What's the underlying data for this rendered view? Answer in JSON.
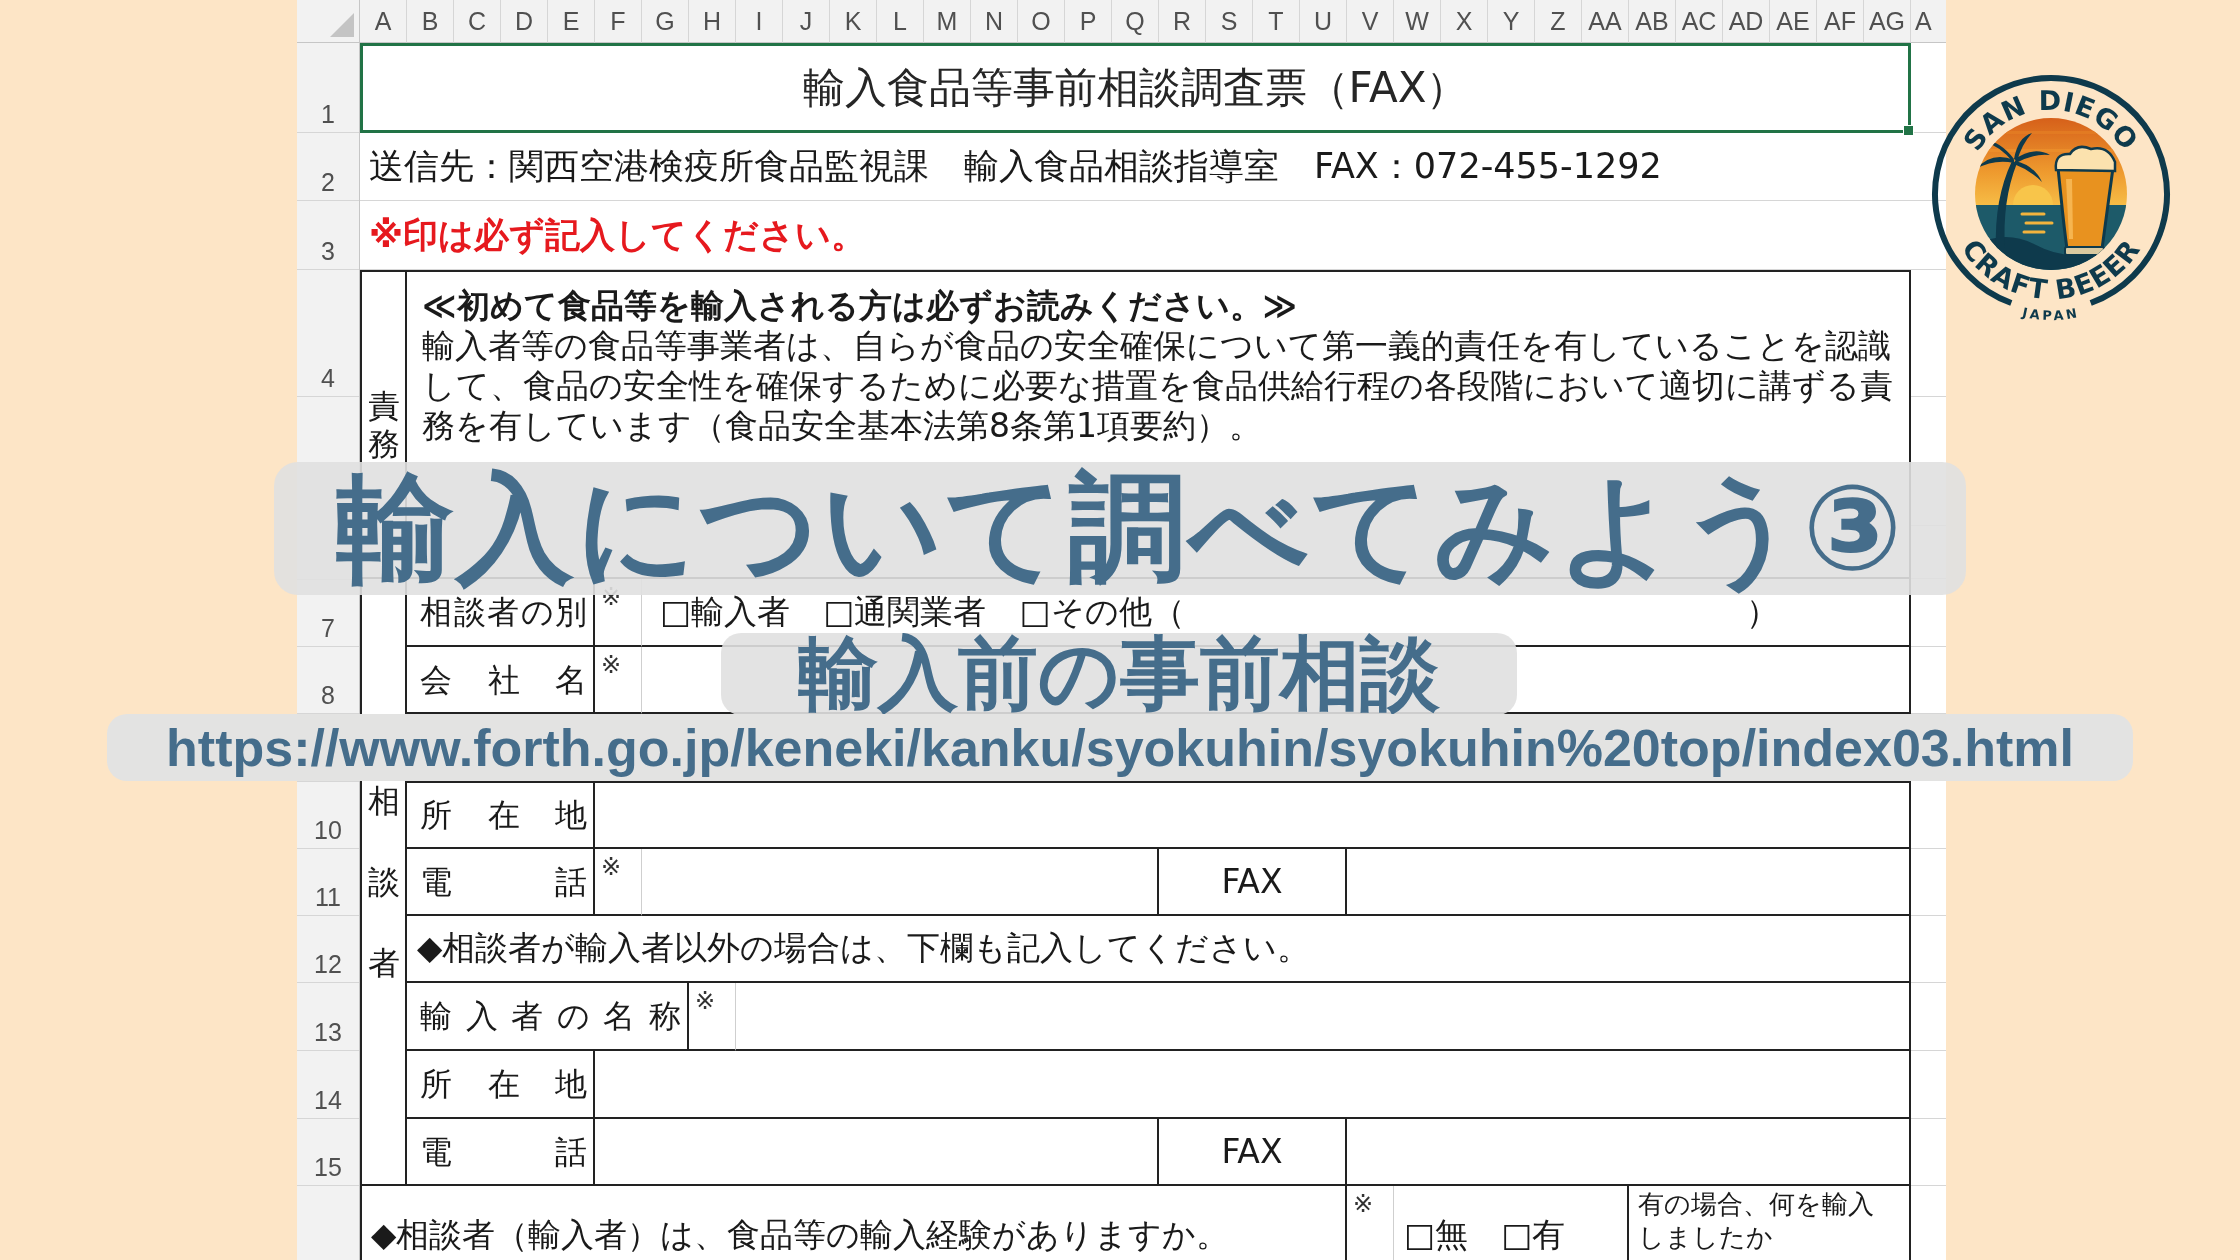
{
  "sheet": {
    "column_headers": [
      "A",
      "B",
      "C",
      "D",
      "E",
      "F",
      "G",
      "H",
      "I",
      "J",
      "K",
      "L",
      "M",
      "N",
      "O",
      "P",
      "Q",
      "R",
      "S",
      "T",
      "U",
      "V",
      "W",
      "X",
      "Y",
      "Z",
      "AA",
      "AB",
      "AC",
      "AD",
      "AE",
      "AF",
      "AG",
      "A"
    ],
    "title_row": {
      "number": "1",
      "text": "輸入食品等事前相談調査票（FAX）",
      "selected": true
    },
    "address_row": {
      "number": "2",
      "text": "送信先：関西空港検疫所食品監視課　輸入食品相談指導室　FAX：072-455-1292"
    },
    "notice_row": {
      "number": "3",
      "text": "※印は必ず記入してください。"
    },
    "responsibility": {
      "number": "4",
      "label": "責務",
      "heading": "≪初めて食品等を輸入される方は必ずお読みください。≫",
      "paragraph": "輸入者等の食品等事業者は、自らが食品の安全確保について第一義的責任を有していることを認識して、食品の安全性を確保するために必要な措置を食品供給行程の各段階において適切に講ずる責務を有しています（食品安全基本法第8条第1項要約）。"
    },
    "consultant": {
      "label": "相談者",
      "rows": [
        {
          "number": "7",
          "kind": "choice",
          "label": "相談者の別",
          "mark": "※",
          "options": [
            "□輸入者",
            "□通関業者",
            "□その他（"
          ],
          "closing": "）"
        },
        {
          "number": "8",
          "kind": "field",
          "label": "会社名",
          "mark": "※"
        },
        {
          "number": "10",
          "kind": "field",
          "label": "所在地"
        },
        {
          "number": "11",
          "kind": "phone",
          "label": "電話",
          "mark": "※",
          "fax_label": "FAX"
        },
        {
          "number": "12",
          "kind": "note",
          "text": "◆相談者が輸入者以外の場合は、下欄も記入してください。"
        },
        {
          "number": "13",
          "kind": "wide_field",
          "label": "輸入者の名称",
          "mark": "※"
        },
        {
          "number": "14",
          "kind": "field",
          "label": "所在地"
        },
        {
          "number": "15",
          "kind": "phone",
          "label": "電話",
          "fax_label": "FAX"
        }
      ]
    },
    "experience_row": {
      "question": "◆相談者（輸入者）は、食品等の輸入経験がありますか。",
      "mark": "※",
      "options": [
        "□無",
        "□有"
      ],
      "followup": "有の場合、何を輸入しましたか"
    }
  },
  "overlay": {
    "title": "輸入について調べてみよう③",
    "subtitle": "輸入前の事前相談",
    "url": "https://www.forth.go.jp/keneki/kanku/syokuhin/syokuhin%20top/index03.html"
  },
  "logo": {
    "top_text": "SAN DIEGO",
    "bottom_text": "CRAFT BEEER",
    "tagline": "JAPAN"
  }
}
